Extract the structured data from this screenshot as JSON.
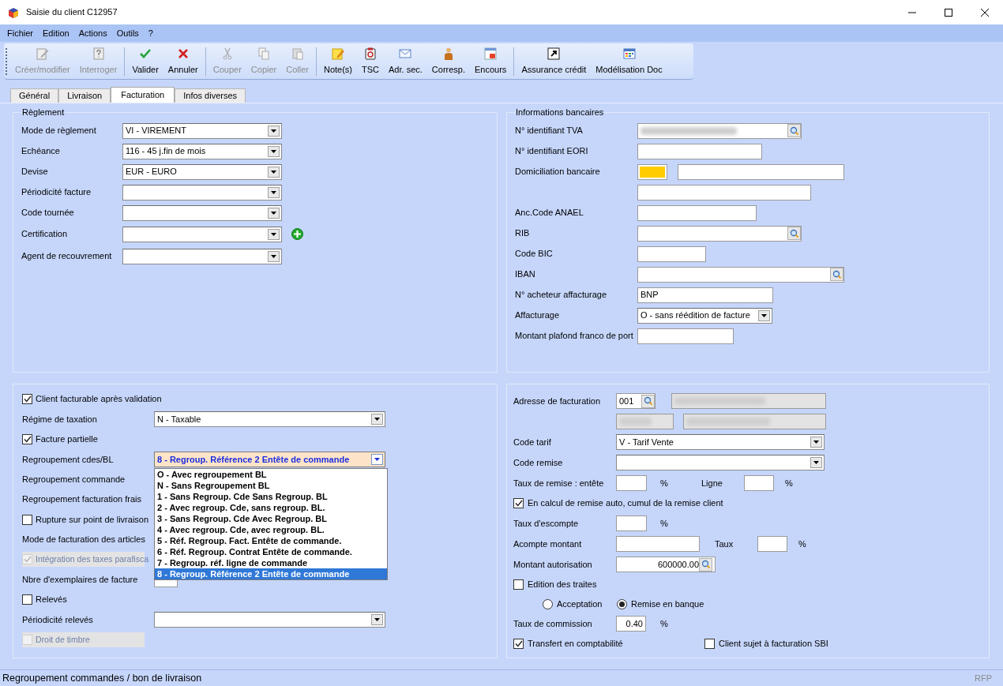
{
  "window": {
    "title": "Saisie du client C12957"
  },
  "menu": [
    "Fichier",
    "Edition",
    "Actions",
    "Outils",
    "?"
  ],
  "toolbar": [
    [
      {
        "label": "Créer/modifier",
        "kind": "edit",
        "disabled": true
      },
      {
        "label": "Interroger",
        "kind": "query",
        "disabled": true
      }
    ],
    [
      {
        "label": "Valider",
        "kind": "ok",
        "disabled": false
      },
      {
        "label": "Annuler",
        "kind": "cancel",
        "disabled": false
      }
    ],
    [
      {
        "label": "Couper",
        "kind": "cut",
        "disabled": true
      },
      {
        "label": "Copier",
        "kind": "copy",
        "disabled": true
      },
      {
        "label": "Coller",
        "kind": "paste",
        "disabled": true
      }
    ],
    [
      {
        "label": "Note(s)",
        "kind": "note",
        "disabled": false
      },
      {
        "label": "TSC",
        "kind": "tsc",
        "disabled": false
      },
      {
        "label": "Adr. sec.",
        "kind": "mail",
        "disabled": false
      },
      {
        "label": "Corresp.",
        "kind": "person",
        "disabled": false
      },
      {
        "label": "Encours",
        "kind": "window",
        "disabled": false
      }
    ],
    [
      {
        "label": "Assurance crédit",
        "kind": "link",
        "disabled": false
      },
      {
        "label": "Modélisation Doc",
        "kind": "grid",
        "disabled": false
      }
    ]
  ],
  "tabs": [
    {
      "label": "Général",
      "selected": false
    },
    {
      "label": "Livraison",
      "selected": false
    },
    {
      "label": "Facturation",
      "selected": true
    },
    {
      "label": "Infos diverses",
      "selected": false
    }
  ],
  "reglement": {
    "title": "Règlement",
    "fields": [
      {
        "label": "Mode de règlement",
        "kind": "select",
        "value": "VI - VIREMENT"
      },
      {
        "label": "Echéance",
        "kind": "select",
        "value": "116 - 45 j.fin de mois"
      },
      {
        "label": "Devise",
        "kind": "select",
        "value": "EUR - EURO"
      },
      {
        "label": "Périodicité facture",
        "kind": "select"
      },
      {
        "label": "Code tournée",
        "kind": "select"
      },
      {
        "label": "Certification",
        "kind": "select_add"
      },
      {
        "label": "Agent de recouvrement",
        "kind": "select"
      }
    ]
  },
  "bancaires": {
    "title": "Informations bancaires",
    "fields": [
      {
        "label": "N° identifiant TVA",
        "kind": "search",
        "redacted": true
      },
      {
        "label": "N° identifiant EORI",
        "kind": "text"
      },
      {
        "label": "Domiciliation bancaire",
        "kind": "color_text",
        "color": "#ffcc00"
      },
      {
        "kind": "text"
      },
      {
        "label": "Anc.Code ANAEL",
        "kind": "text"
      },
      {
        "label": "RIB",
        "kind": "search"
      },
      {
        "label": "Code BIC",
        "kind": "text"
      },
      {
        "label": "IBAN",
        "kind": "search"
      },
      {
        "label": "N° acheteur affacturage",
        "kind": "text",
        "value": "BNP"
      },
      {
        "label": "Affacturage",
        "kind": "select",
        "value": "O - sans réédition de facture"
      },
      {
        "label": "Montant plafond franco de port",
        "kind": "text"
      }
    ]
  },
  "options": [
    {
      "kind": "checkbox",
      "label": "Client facturable après validation",
      "checked": true,
      "disabled": false
    },
    {
      "kind": "select",
      "label": "Régime de taxation",
      "value": "N - Taxable"
    },
    {
      "kind": "checkbox",
      "label": "Facture partielle",
      "checked": true,
      "disabled": false
    },
    {
      "kind": "open_select",
      "label": "Regroupement cdes/BL",
      "value": "8 - Regroup. Référence 2 Entête de commande",
      "options": [
        {
          "label": "O - Avec regroupement BL",
          "selected": false
        },
        {
          "label": "N - Sans Regroupement BL",
          "selected": false
        },
        {
          "label": "1 - Sans Regroup. Cde Sans Regroup. BL",
          "selected": false
        },
        {
          "label": "2 - Avec regroup. Cde, sans regroup. BL.",
          "selected": false
        },
        {
          "label": "3 - Sans Regroup. Cde Avec Regroup. BL",
          "selected": false
        },
        {
          "label": "4 - Avec regroup. Cde, avec regroup. BL.",
          "selected": false
        },
        {
          "label": "5 - Réf. Regroup. Fact. Entête de commande.",
          "selected": false
        },
        {
          "label": "6 - Réf. Regroup. Contrat Entête de commande.",
          "selected": false
        },
        {
          "label": "7 - Regroup. réf. ligne de commande",
          "selected": false
        },
        {
          "label": "8 - Regroup. Référence 2 Entête de commande",
          "selected": true
        }
      ]
    },
    {
      "kind": "label",
      "label": "Regroupement commande"
    },
    {
      "kind": "label",
      "label": "Regroupement facturation frais"
    },
    {
      "kind": "checkbox",
      "label": "Rupture sur point de livraison",
      "checked": false,
      "disabled": false
    },
    {
      "kind": "label",
      "label": "Mode de facturation des articles"
    },
    {
      "kind": "checkbox",
      "label": "Intégration des taxes parafisca",
      "checked": true,
      "disabled": true
    },
    {
      "kind": "text",
      "label": "Nbre d'exemplaires de facture"
    },
    {
      "kind": "checkbox",
      "label": "Relevés",
      "checked": false,
      "disabled": false
    },
    {
      "kind": "select",
      "label": "Périodicité relevés"
    },
    {
      "kind": "checkbox",
      "label": "Droit de timbre",
      "checked": false,
      "disabled": true
    }
  ],
  "facturation": {
    "adresse": {
      "label": "Adresse de facturation",
      "code": "001"
    },
    "code_tarif": {
      "label": "Code tarif",
      "value": "V - Tarif Vente"
    },
    "code_remise": {
      "label": "Code remise"
    },
    "taux_remise": {
      "label": "Taux de remise : entête",
      "unit": "%",
      "ligne_label": "Ligne",
      "ligne_unit": "%"
    },
    "cumul": {
      "label": "En calcul de remise auto, cumul de la remise client",
      "checked": true
    },
    "escompte": {
      "label": "Taux d'escompte",
      "unit": "%"
    },
    "acompte": {
      "label": "Acompte montant",
      "taux_label": "Taux",
      "unit": "%"
    },
    "autorisation": {
      "label": "Montant autorisation",
      "value": "600000.00"
    },
    "traites": {
      "label": "Edition des traites",
      "checked": false
    },
    "mode_traites": [
      {
        "label": "Acceptation",
        "selected": false
      },
      {
        "label": "Remise en banque",
        "selected": true
      }
    ],
    "commission": {
      "label": "Taux de commission",
      "value": "0.40",
      "unit": "%"
    },
    "transfert": {
      "label": "Transfert en comptabilité",
      "checked": true
    },
    "sbi": {
      "label": "Client sujet à facturation SBI",
      "checked": false
    }
  },
  "status_bar": {
    "text": "Regroupement commandes / bon de livraison",
    "right": "RFP"
  }
}
